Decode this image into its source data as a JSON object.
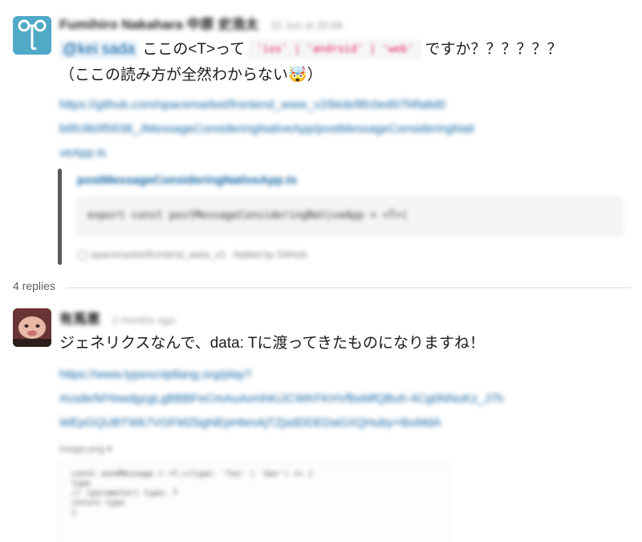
{
  "thread": {
    "parent": {
      "author": "Fumihiro Nakahara 中原 史浩太",
      "timestamp": "22 Jun at 20:08",
      "mention": "@kei sada",
      "text_before_code": "ここの<T>って",
      "inline_code": "'ios' | 'android' | 'web'",
      "text_after_code": "ですか？？？？？？",
      "text_line2": "（ここの読み方が全然わからない🤯）",
      "link_lines": [
        "https://github.com/spacemarket/frontend_www_v2/blob/8fc0ed97f4fa8d0",
        "b6fc9b0f5638_JMessageConsideringNativeApp/postMessageConsideringNati",
        "veApp.ts"
      ],
      "attachment": {
        "title": "postMessageConsideringNativeApp.ts",
        "code": "export const postMessageConsideringNativeApp = <T>(",
        "footer": "spacemarket/frontend_www_v2 · Added by GitHub"
      }
    },
    "replies_label": "4 replies",
    "reply": {
      "author": "有馬恵",
      "timestamp": "2 months ago",
      "text": "ジェネリクスなんで、data: Tに渡ってきたものになりますね！",
      "link_lines": [
        "https://www.typescriptlang.org/play?",
        "#code/MYewdgzgLgBBBFeCmAuAvmhKiJCWKFKHVfbsMfQBuh-4Cg0NNuKz_J7h",
        "WEpGQUBTWk7VGFMZbgNEpHtenAjTZjsdDDEDaGXQHuby+tbxMdA"
      ],
      "image_label": "image.png ▾",
      "image_code_lines": [
        "const sendMessage = <T,>(type: 'foo' | 'bar') => {",
        "  type",
        "  // (parameter) type: T",
        "  return type",
        "}"
      ]
    }
  }
}
